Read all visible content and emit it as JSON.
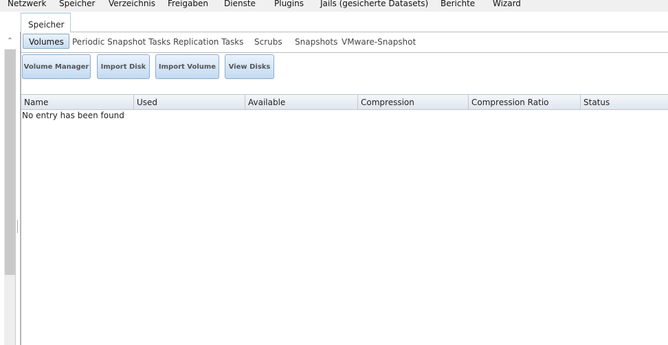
{
  "menu": [
    "Netzwerk",
    "Speicher",
    "Verzeichnis",
    "Freigaben",
    "Dienste",
    "Plugins",
    "Jails (gesicherte Datasets)",
    "Berichte",
    "Wizard"
  ],
  "tab": "Speicher",
  "subtabs": [
    "Volumes",
    "Periodic Snapshot Tasks",
    "Replication Tasks",
    "Scrubs",
    "Snapshots",
    "VMware-Snapshot"
  ],
  "buttons": [
    "Volume Manager",
    "Import Disk",
    "Import Volume",
    "View Disks"
  ],
  "columns": [
    "Name",
    "Used",
    "Available",
    "Compression",
    "Compression Ratio",
    "Status"
  ],
  "empty_message": "No entry has been found"
}
